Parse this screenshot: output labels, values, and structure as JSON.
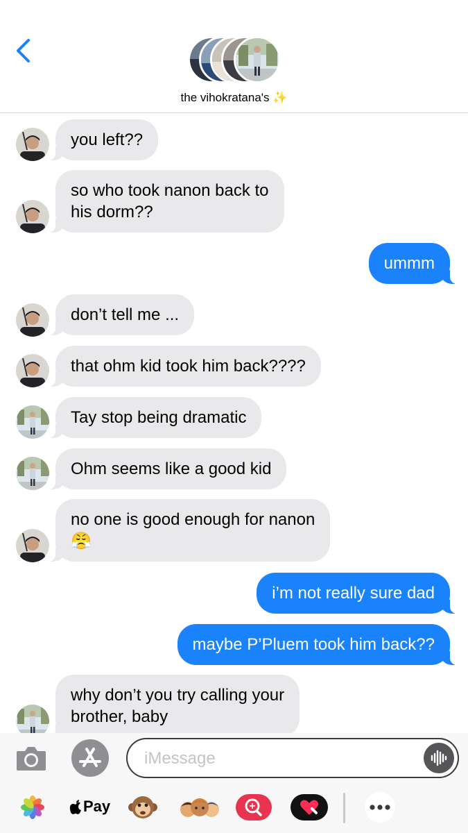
{
  "header": {
    "back_icon": "chevron-left-icon",
    "group_title": "the vihokratana's ✨",
    "accent_color": "#1a82fb"
  },
  "messages": [
    {
      "direction": "in",
      "sender_avatar": "dad-dark",
      "text": "you left??"
    },
    {
      "direction": "in",
      "sender_avatar": "dad-dark",
      "lines": [
        "so who took nanon back to",
        "his dorm??"
      ]
    },
    {
      "direction": "out",
      "text": "ummm"
    },
    {
      "direction": "in",
      "sender_avatar": "dad-dark",
      "text": "don’t tell me ..."
    },
    {
      "direction": "in",
      "sender_avatar": "dad-dark",
      "text": "that ohm kid took him back????"
    },
    {
      "direction": "in",
      "sender_avatar": "dad-outdoor",
      "text": "Tay stop being dramatic"
    },
    {
      "direction": "in",
      "sender_avatar": "dad-outdoor",
      "text": "Ohm seems like a good kid"
    },
    {
      "direction": "in",
      "sender_avatar": "dad-dark",
      "lines": [
        "no one is good enough for nanon",
        "😤"
      ]
    },
    {
      "direction": "out",
      "text": "i’m not really sure dad"
    },
    {
      "direction": "out",
      "text": "maybe P’Pluem took him back??"
    },
    {
      "direction": "in",
      "sender_avatar": "dad-outdoor",
      "lines": [
        "why don’t you try calling your",
        "brother, baby"
      ]
    }
  ],
  "input_bar": {
    "camera_icon": "camera-icon",
    "appstore_icon": "app-store-icon",
    "placeholder": "iMessage",
    "audio_icon": "audio-waveform-icon"
  },
  "app_drawer": {
    "items": [
      {
        "icon": "photos-icon"
      },
      {
        "icon": "apple-pay-icon",
        "label": "Pay"
      },
      {
        "icon": "monkey-animoji-icon"
      },
      {
        "icon": "memoji-stickers-icon"
      },
      {
        "icon": "image-search-icon"
      },
      {
        "icon": "heart-digital-touch-icon"
      },
      {
        "icon": "more-icon"
      }
    ]
  },
  "colors": {
    "incoming_bubble": "#e9e9eb",
    "outgoing_bubble": "#1a82fb",
    "divider": "#d9d9de"
  }
}
